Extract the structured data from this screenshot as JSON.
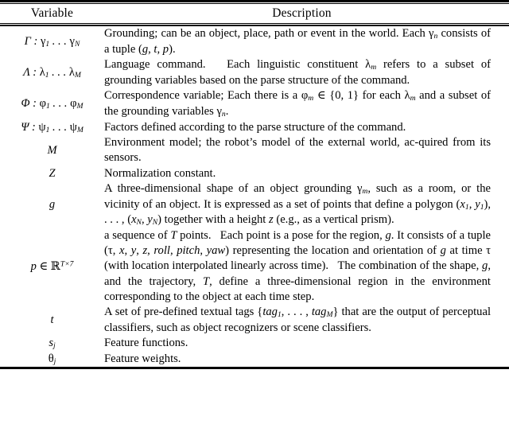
{
  "document": {
    "type": "academic-table",
    "style": "booktabs",
    "columns": [
      "Variable",
      "Description"
    ]
  },
  "table": {
    "header": {
      "variable": "Variable",
      "description": "Description"
    },
    "rows": [
      {
        "id": "gamma",
        "variable_plain": "Γ : γ₁ … γ_N",
        "variable_html": "&Gamma; : <i class=\"grk\">&gamma;</i><sub>1</sub> . . . <i class=\"grk\">&gamma;</i><sub>N</sub>",
        "description_plain": "Grounding; can be an object, place, path or event in the world. Each γn consists of a tuple (g, t, p).",
        "description_html": "Grounding; can be an object, place, path or event in the world. Each <i class=\"grk\">&gamma;</i><sub>n</sub> consists of a tuple (<i class=\"m\">g</i>, <i class=\"m\">t</i>, <i class=\"m\">p</i>)."
      },
      {
        "id": "lambda",
        "variable_plain": "Λ : λ₁ … λ_M",
        "variable_html": "&Lambda; : <i class=\"grk\">&lambda;</i><sub>1</sub> . . . <i class=\"grk\">&lambda;</i><sub>M</sub>",
        "description_plain": "Language command. Each linguistic constituent λm refers to a subset of grounding variables based on the parse structure of the command.",
        "description_html": "Language command.&nbsp;&nbsp; Each linguistic constituent <i class=\"grk\">&lambda;</i><sub>m</sub> refers to a subset of grounding variables based on the parse structure of the command."
      },
      {
        "id": "phi",
        "variable_plain": "Φ : φ₁ … φ_M",
        "variable_html": "&Phi; : <i class=\"grk\">&phi;</i><sub>1</sub> . . . <i class=\"grk\">&phi;</i><sub>M</sub>",
        "description_plain": "Correspondence variable; Each there is a φm ∈ {0, 1} for each λm and a subset of the grounding variables γn.",
        "description_html": "Correspondence variable; Each there is a <i class=\"grk\">&phi;</i><sub>m</sub> &isin; {0, 1} for each <i class=\"grk\">&lambda;</i><sub>m</sub> and a subset of the grounding variables <i class=\"grk\">&gamma;</i><sub>n</sub>."
      },
      {
        "id": "psi",
        "variable_plain": "Ψ : ψ₁ … ψ_M",
        "variable_html": "&Psi; : <i class=\"grk\">&psi;</i><sub>1</sub> . . . <i class=\"grk\">&psi;</i><sub>M</sub>",
        "description_plain": "Factors defined according to the parse structure of the command.",
        "description_html": "Factors defined according to the parse structure of the command."
      },
      {
        "id": "M",
        "variable_plain": "M",
        "variable_html": "<i class=\"m\">M</i>",
        "description_plain": "Environment model; the robot's model of the external world, acquired from its sensors.",
        "description_html": "Environment model; the robot&rsquo;s model of the external world, ac-quired from its sensors."
      },
      {
        "id": "Z",
        "variable_plain": "Z",
        "variable_html": "<i class=\"m\">Z</i>",
        "description_plain": "Normalization constant.",
        "description_html": "Normalization constant."
      },
      {
        "id": "g",
        "variable_plain": "g",
        "variable_html": "<i class=\"m\">g</i>",
        "description_plain": "A three-dimensional shape of an object grounding γm, such as a room, or the vicinity of an object. It is expressed as a set of points that define a polygon (x1, y1), . . . , (xN, yN) together with a height z (e.g., as a vertical prism).",
        "description_html": "A three-dimensional shape of an object grounding <i class=\"grk\">&gamma;</i><sub>m</sub>, such as a room, or the vicinity of an object. It is expressed as a set of points that define a polygon (<i class=\"m\">x</i><sub>1</sub>, <i class=\"m\">y</i><sub>1</sub>), . . . , (<i class=\"m\">x</i><sub>N</sub>, <i class=\"m\">y</i><sub>N</sub>) together with a height <i class=\"m\">z</i> (e.g., as a vertical prism)."
      },
      {
        "id": "p",
        "variable_plain": "p ∈ ℝ^{T×7}",
        "variable_html": "<i class=\"m\">p</i> &isin; <span class=\"bb\">&#8477;</span><sup><i>T</i>&times;7</sup>",
        "description_plain": "a sequence of T points. Each point is a pose for the region, g. It consists of a tuple (τ, x, y, z, roll, pitch, yaw) representing the location and orientation of g at time τ (with location interpolated linearly across time). The combination of the shape, g, and the trajectory, T, define a three-dimensional region in the environment corresponding to the object at each time step.",
        "description_html": "a sequence of <i class=\"m\">T</i> points.&nbsp;&nbsp; Each point is a pose for the region, <i class=\"m\">g</i>. It consists of a tuple (<i class=\"grk\">&tau;</i>, <i class=\"m\">x</i>, <i class=\"m\">y</i>, <i class=\"m\">z</i>, <i class=\"m\">roll</i>, <i class=\"m\">pitch</i>, <i class=\"m\">yaw</i>) representing the location and orientation of <i class=\"m\">g</i> at time <i class=\"grk\">&tau;</i> (with location interpolated linearly across time).&nbsp;&nbsp; The combination of the shape, <i class=\"m\">g</i>, and the trajectory, <i class=\"m\">T</i>, define a three-dimensional region in the environment corresponding to the object at each time step."
      },
      {
        "id": "t",
        "variable_plain": "t",
        "variable_html": "<i class=\"m\">t</i>",
        "description_plain": "A set of pre-defined textual tags {tag1, . . . , tagM} that are the output of perceptual classifiers, such as object recognizers or scene classifiers.",
        "description_html": "A set of pre-defined textual tags {<i class=\"m\">tag</i><sub>1</sub>, . . . , <i class=\"m\">tag</i><sub>M</sub>} that are the output of perceptual classifiers, such as object recognizers or scene classifiers."
      },
      {
        "id": "s_j",
        "variable_plain": "s_j",
        "variable_html": "<i class=\"m\">s</i><sub>j</sub>",
        "description_plain": "Feature functions.",
        "description_html": "Feature functions."
      },
      {
        "id": "theta_j",
        "variable_plain": "θ_j",
        "variable_html": "<i class=\"grk\">&theta;</i><sub>j</sub>",
        "description_plain": "Feature weights.",
        "description_html": "Feature weights."
      }
    ]
  }
}
